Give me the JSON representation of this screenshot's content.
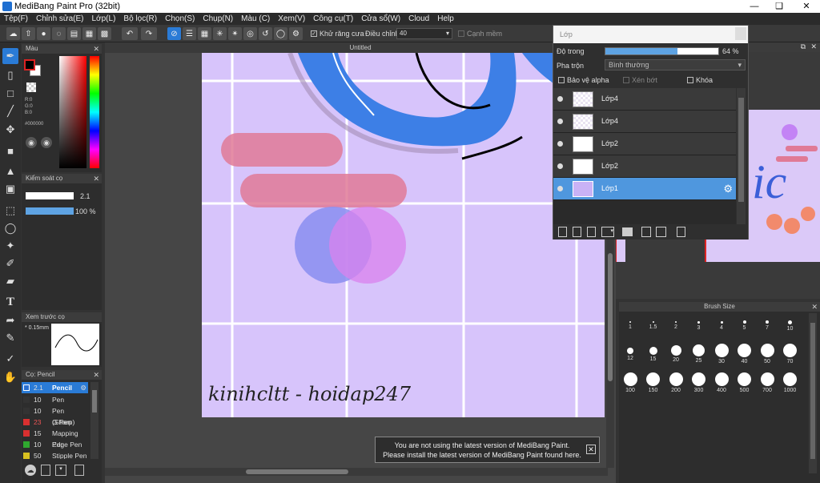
{
  "window": {
    "title": "MediBang Paint Pro (32bit)"
  },
  "menu": [
    "Tệp(F)",
    "Chỉnh sửa(E)",
    "Lớp(L)",
    "Bộ lọc(R)",
    "Chọn(S)",
    "Chụp(N)",
    "Màu (C)",
    "Xem(V)",
    "Công cụ(T)",
    "Cửa sổ(W)",
    "Cloud",
    "Help"
  ],
  "toolbar": {
    "antialias_label": "Khử răng cưa",
    "correction_label": "Điều chỉnh",
    "correction_value": "40",
    "edge_label": "Cạnh mềm"
  },
  "color_panel": {
    "title": "Màu",
    "r": "R:0",
    "g": "G:0",
    "b": "B:0",
    "hex": "#000000",
    "fg": "#000000",
    "bg": "#ffffff"
  },
  "brush_control": {
    "title": "Kiểm soát cọ",
    "size": "2.1",
    "opacity": "100 %"
  },
  "brush_preview": {
    "title": "Xem trước cọ",
    "size": "* 0.15mm"
  },
  "brush_list": {
    "title": "Cọ: Pencil",
    "items": [
      {
        "size": "2.1",
        "name": "Pencil",
        "color": "#2a6fd0"
      },
      {
        "size": "10",
        "name": "Pen",
        "color": "#333333"
      },
      {
        "size": "10",
        "name": "Pen (Sharp)",
        "color": "#333333"
      },
      {
        "size": "23",
        "name": "G Pen",
        "color": "#d93030"
      },
      {
        "size": "15",
        "name": "Mapping Pen",
        "color": "#d93030"
      },
      {
        "size": "10",
        "name": "Edge Pen",
        "color": "#2fa82f"
      },
      {
        "size": "50",
        "name": "Stipple Pen",
        "color": "#d8c020"
      }
    ]
  },
  "document": {
    "tab": "Untitled",
    "signature": "kinihcltt - hoidap247"
  },
  "layer_panel": {
    "title": "Lớp",
    "opacity_label": "Độ trong",
    "opacity_value": "64 %",
    "opacity": 0.64,
    "blend_label": "Pha trộn",
    "blend_value": "Bình thường",
    "protect_alpha": "Bảo vệ alpha",
    "clipping": "Xén bớt",
    "lock": "Khóa",
    "layers": [
      "Lớp4",
      "Lớp4",
      "Lớp2",
      "Lớp2",
      "Lớp1"
    ],
    "selected_index": 4
  },
  "brush_size_panel": {
    "title": "Brush Size",
    "sizes": [
      "1",
      "1.5",
      "2",
      "3",
      "4",
      "5",
      "7",
      "10",
      "12",
      "15",
      "20",
      "25",
      "30",
      "40",
      "50",
      "70",
      "100",
      "150",
      "200",
      "300",
      "400",
      "500",
      "700",
      "1000"
    ]
  },
  "notification": {
    "line1": "You are not using the latest version of MediBang Paint.",
    "line2": "Please install the latest version of MediBang Paint found here."
  }
}
